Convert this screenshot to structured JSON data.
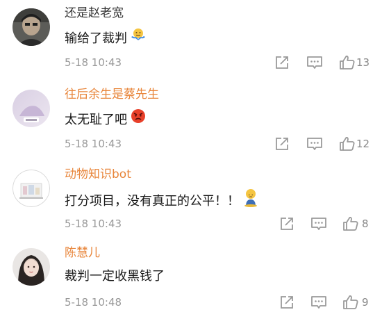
{
  "colors": {
    "username_default": "#333333",
    "username_highlight": "#e8853a",
    "text": "#1a1a1a",
    "meta": "#999999",
    "icon": "#9a9a9a"
  },
  "icons": {
    "share": "share-icon",
    "comment": "comment-icon",
    "like": "thumbs-up-icon"
  },
  "comments": [
    {
      "username": "还是赵老宽",
      "text": "输给了裁判",
      "emoji": "shrug-emoji",
      "time": "5-18 10:43",
      "likes": "13"
    },
    {
      "username": "往后余生是蔡先生",
      "text": "太无耻了吧",
      "emoji": "angry-face-emoji",
      "time": "5-18 10:43",
      "likes": "12"
    },
    {
      "username": "动物知识bot",
      "text": "打分项目，没有真正的公平！！",
      "emoji": "sad-sitting-emoji",
      "time": "5-18 10:43",
      "likes": "8"
    },
    {
      "username": "陈慧儿",
      "text": "裁判一定收黑钱了",
      "emoji": "",
      "time": "5-18 10:48",
      "likes": "9"
    }
  ]
}
